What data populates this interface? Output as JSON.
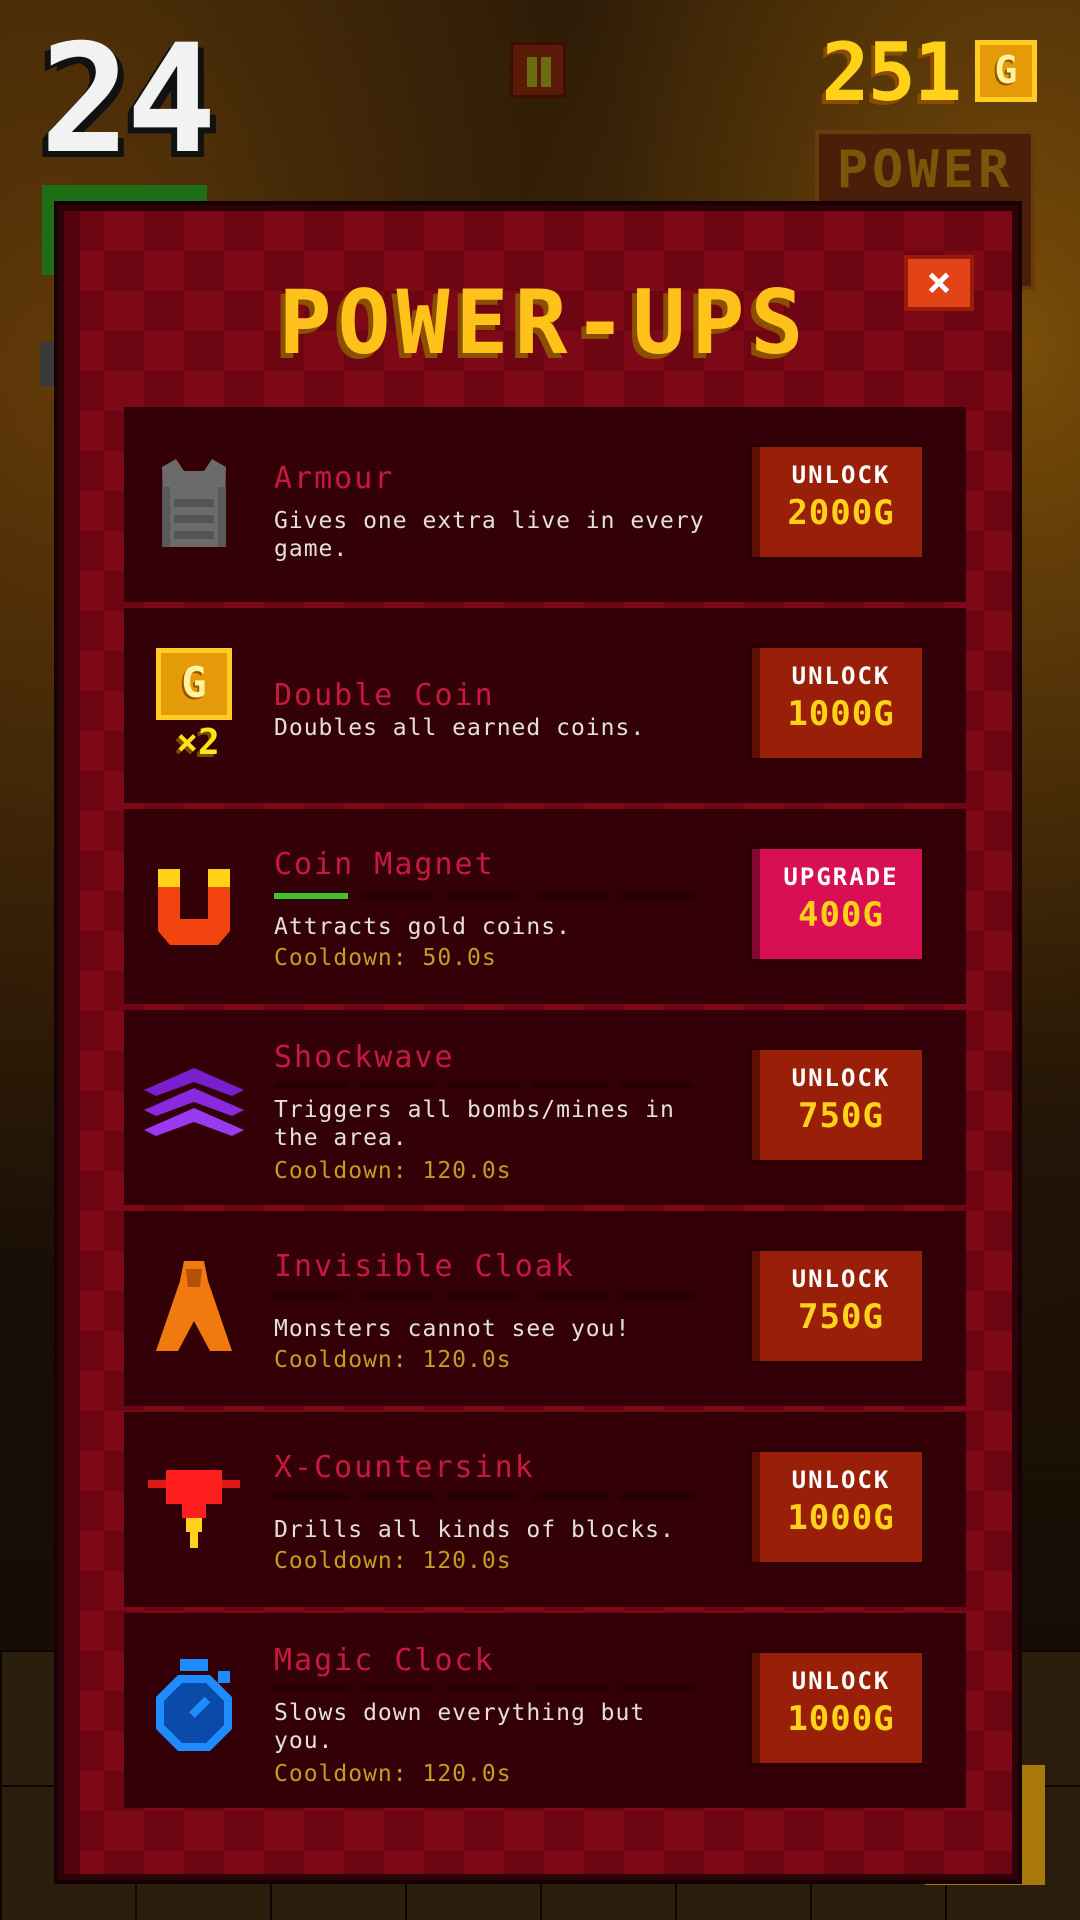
{
  "hud": {
    "score": "24",
    "coins": "251",
    "coin_symbol": "G",
    "background_sign": "POWER"
  },
  "dialog": {
    "title": "POWER-UPS",
    "close_label": "×"
  },
  "powerups": [
    {
      "name": "Armour",
      "description": "Gives one extra live in every game.",
      "cooldown": "",
      "action": "UNLOCK",
      "price": "2000G",
      "icon": "armour-vest-icon",
      "level": null
    },
    {
      "name": "Double Coin",
      "description": "Doubles all earned coins.",
      "cooldown": "",
      "action": "UNLOCK",
      "price": "1000G",
      "icon": "double-coin-icon",
      "icon_badge": "×2",
      "icon_letter": "G",
      "level": null
    },
    {
      "name": "Coin Magnet",
      "description": "Attracts gold coins.",
      "cooldown": "Cooldown: 50.0s",
      "action": "UPGRADE",
      "price": "400G",
      "icon": "magnet-icon",
      "level": 1,
      "max_level": 5
    },
    {
      "name": "Shockwave",
      "description": "Triggers all bombs/mines in the area.",
      "cooldown": "Cooldown: 120.0s",
      "action": "UNLOCK",
      "price": "750G",
      "icon": "shockwave-icon",
      "level": 0,
      "max_level": 5
    },
    {
      "name": "Invisible Cloak",
      "description": "Monsters cannot see you!",
      "cooldown": "Cooldown: 120.0s",
      "action": "UNLOCK",
      "price": "750G",
      "icon": "cloak-icon",
      "level": 0,
      "max_level": 5
    },
    {
      "name": "X-Countersink",
      "description": "Drills all kinds of blocks.",
      "cooldown": "Cooldown: 120.0s",
      "action": "UNLOCK",
      "price": "1000G",
      "icon": "drill-icon",
      "level": 0,
      "max_level": 5
    },
    {
      "name": "Magic Clock",
      "description": "Slows down everything but you.",
      "cooldown": "Cooldown: 120.0s",
      "action": "UNLOCK",
      "price": "1000G",
      "icon": "stopwatch-icon",
      "level": 0,
      "max_level": 5
    }
  ],
  "colors": {
    "title": "#ffc21a",
    "item_name": "#c7183f",
    "cooldown": "#c49c22",
    "unlock_button": "#991f08",
    "upgrade_button": "#d90f56",
    "progress_on": "#3dc52b"
  }
}
